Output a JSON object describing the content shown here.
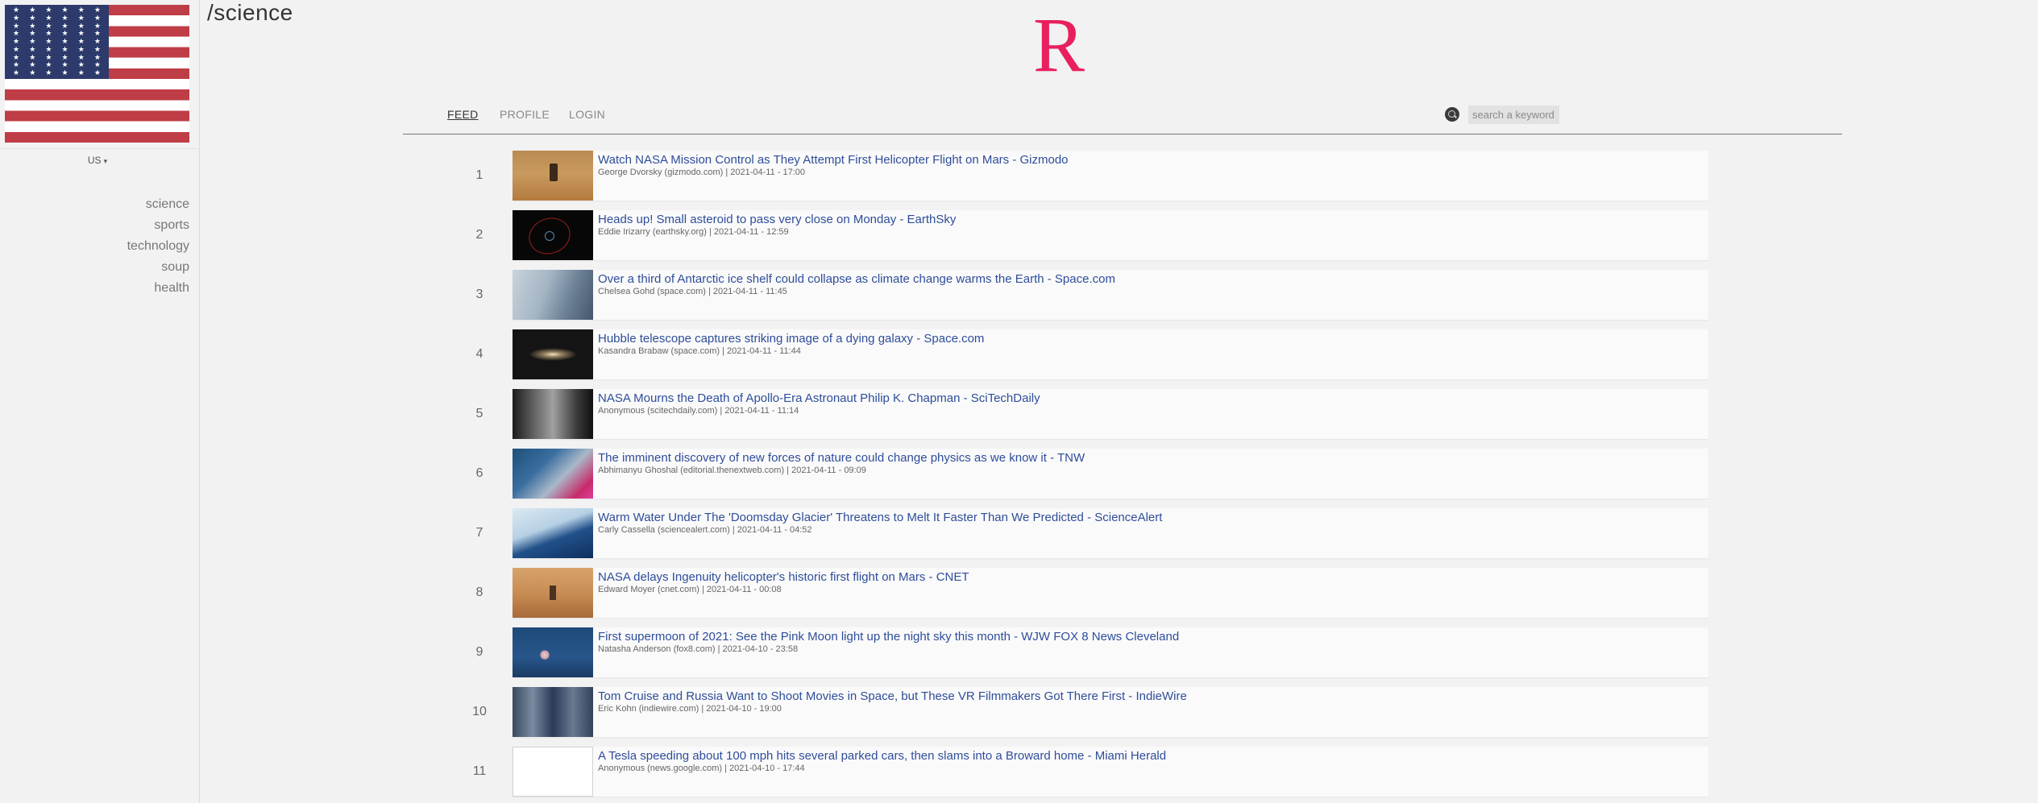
{
  "page_title": "/science",
  "logo": {
    "letter": "R",
    "color": "#e8205d"
  },
  "sidebar": {
    "flag": "us-flag",
    "country_select": {
      "value": "US",
      "caret": "▾"
    },
    "categories": [
      {
        "label": "science"
      },
      {
        "label": "sports"
      },
      {
        "label": "technology"
      },
      {
        "label": "soup"
      },
      {
        "label": "health"
      }
    ]
  },
  "nav": {
    "tabs": [
      {
        "label": "FEED",
        "active": true
      },
      {
        "label": "PROFILE",
        "active": false
      },
      {
        "label": "LOGIN",
        "active": false
      }
    ],
    "search": {
      "placeholder": "search a keyword",
      "icon": "search-icon"
    }
  },
  "feed": {
    "items": [
      {
        "rank": "1",
        "title": "Watch NASA Mission Control as They Attempt First Helicopter Flight on Mars - Gizmodo",
        "meta": "George Dvorsky (gizmodo.com) | 2021-04-11 - 17:00"
      },
      {
        "rank": "2",
        "title": "Heads up! Small asteroid to pass very close on Monday - EarthSky",
        "meta": "Eddie Irizarry (earthsky.org) | 2021-04-11 - 12:59"
      },
      {
        "rank": "3",
        "title": "Over a third of Antarctic ice shelf could collapse as climate change warms the Earth - Space.com",
        "meta": "Chelsea Gohd (space.com) | 2021-04-11 - 11:45"
      },
      {
        "rank": "4",
        "title": "Hubble telescope captures striking image of a dying galaxy - Space.com",
        "meta": "Kasandra Brabaw (space.com) | 2021-04-11 - 11:44"
      },
      {
        "rank": "5",
        "title": "NASA Mourns the Death of Apollo-Era Astronaut Philip K. Chapman - SciTechDaily",
        "meta": "Anonymous (scitechdaily.com) | 2021-04-11 - 11:14"
      },
      {
        "rank": "6",
        "title": "The imminent discovery of new forces of nature could change physics as we know it - TNW",
        "meta": "Abhimanyu Ghoshal (editorial.thenextweb.com) | 2021-04-11 - 09:09"
      },
      {
        "rank": "7",
        "title": "Warm Water Under The 'Doomsday Glacier' Threatens to Melt It Faster Than We Predicted - ScienceAlert",
        "meta": "Carly Cassella (sciencealert.com) | 2021-04-11 - 04:52"
      },
      {
        "rank": "8",
        "title": "NASA delays Ingenuity helicopter's historic first flight on Mars - CNET",
        "meta": "Edward Moyer (cnet.com) | 2021-04-11 - 00:08"
      },
      {
        "rank": "9",
        "title": "First supermoon of 2021: See the Pink Moon light up the night sky this month - WJW FOX 8 News Cleveland",
        "meta": "Natasha Anderson (fox8.com) | 2021-04-10 - 23:58"
      },
      {
        "rank": "10",
        "title": "Tom Cruise and Russia Want to Shoot Movies in Space, but These VR Filmmakers Got There First - IndieWire",
        "meta": "Eric Kohn (indiewire.com) | 2021-04-10 - 19:00"
      },
      {
        "rank": "11",
        "title": "A Tesla speeding about 100 mph hits several parked cars, then slams into a Broward home - Miami Herald",
        "meta": "Anonymous (news.google.com) | 2021-04-10 - 17:44"
      }
    ]
  }
}
